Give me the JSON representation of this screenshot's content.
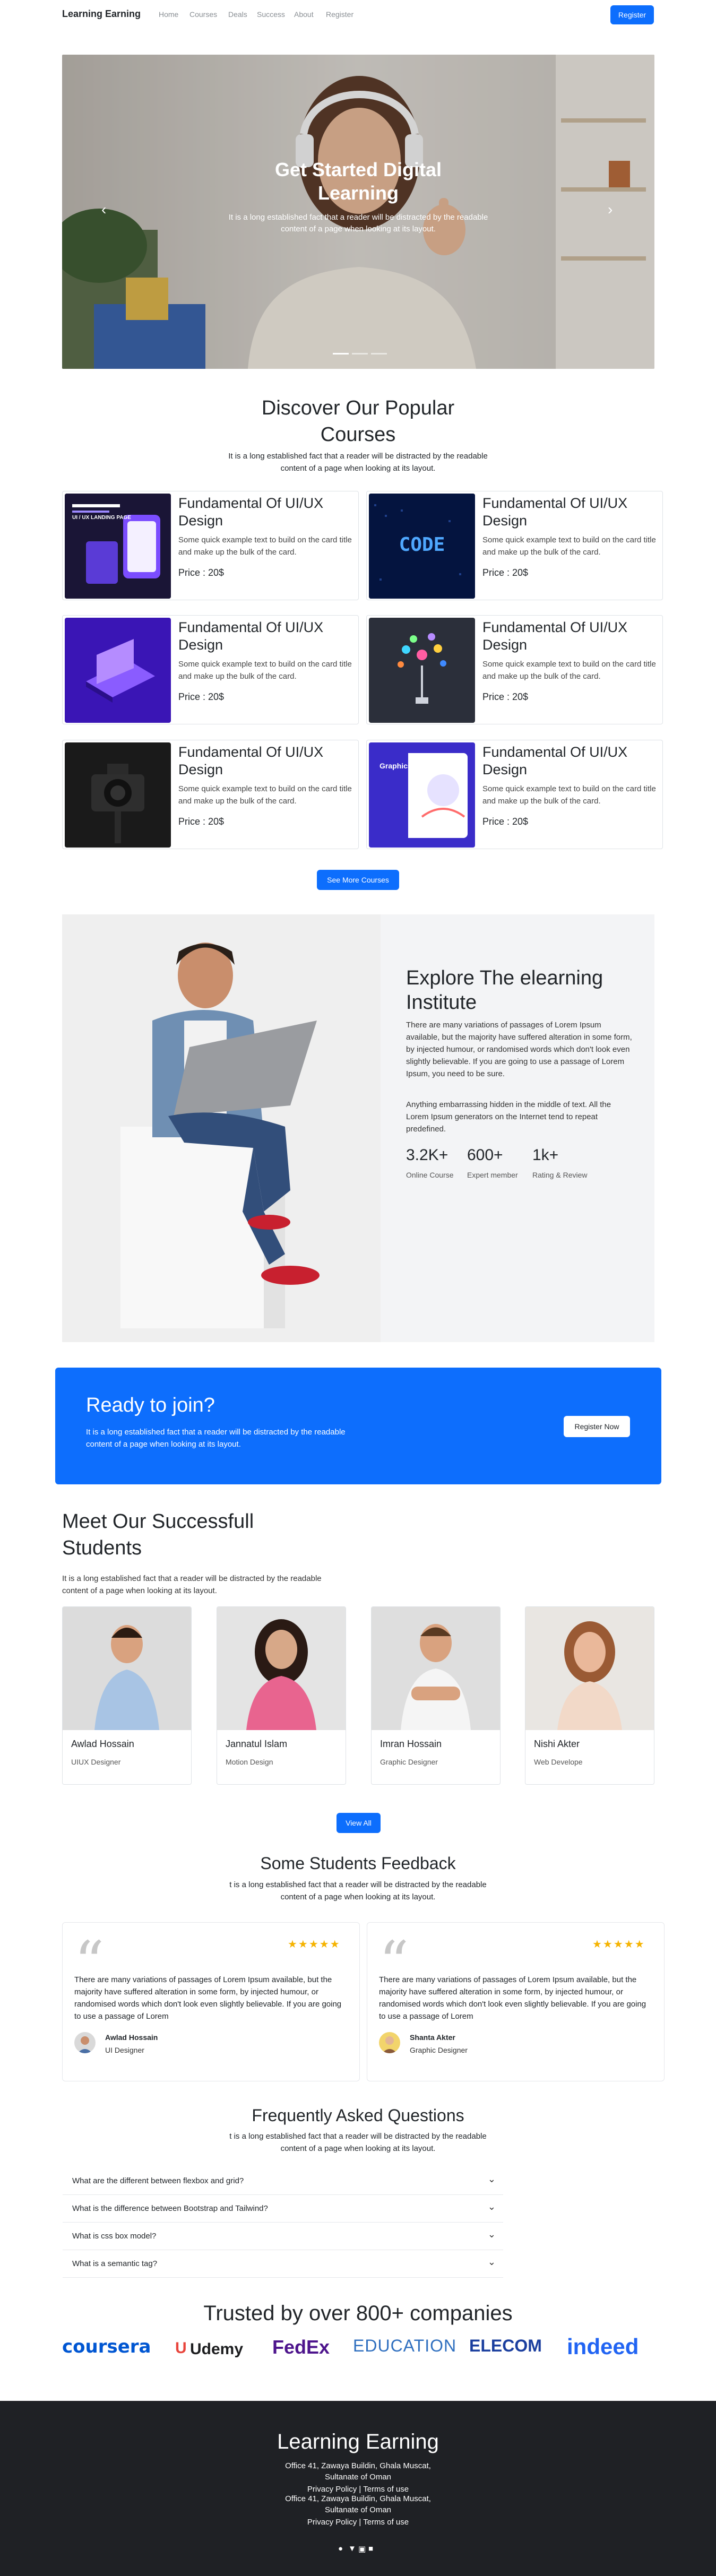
{
  "nav": {
    "brand": "Learning Earning",
    "links": [
      "Home",
      "Courses",
      "Deals",
      "Success",
      "About",
      "Register"
    ],
    "register_button": "Register"
  },
  "hero": {
    "title_line1": "Get Started Digital",
    "title_line2": "Learning",
    "text": "It is a long established fact that a reader will be distracted by the readable content of a page when looking at its layout.",
    "prev_icon": "chevron-left-icon",
    "next_icon": "chevron-right-icon"
  },
  "courses": {
    "title_line1": "Discover Our Popular",
    "title_line2": "Courses",
    "subtitle_line1": "It is a long established fact that a reader will be distracted by the readable",
    "subtitle_line2": "content of a page when looking at its layout.",
    "items": [
      {
        "title": "Fundamental Of UI/UX Design",
        "text": "Some quick example text to build on the card title and make up the bulk of the card.",
        "price": "Price : 20$",
        "image_text": "UI / UX LANDING PAGE",
        "accent": "#7b4dff"
      },
      {
        "title": "Fundamental Of UI/UX Design",
        "text": "Some quick example text to build on the card title and make up the bulk of the card.",
        "price": "Price : 20$",
        "image_text": "CODE",
        "accent": "#1e90ff"
      },
      {
        "title": "Fundamental Of UI/UX Design",
        "text": "Some quick example text to build on the card title and make up the bulk of the card.",
        "price": "Price : 20$",
        "image_text": "",
        "accent": "#6a2cff"
      },
      {
        "title": "Fundamental Of UI/UX Design",
        "text": "Some quick example text to build on the card title and make up the bulk of the card.",
        "price": "Price : 20$",
        "image_text": "",
        "accent": "#2b2f3a"
      },
      {
        "title": "Fundamental Of UI/UX Design",
        "text": "Some quick example text to build on the card title and make up the bulk of the card.",
        "price": "Price : 20$",
        "image_text": "",
        "accent": "#222222"
      },
      {
        "title": "Fundamental Of UI/UX Design",
        "text": "Some quick example text to build on the card title and make up the bulk of the card.",
        "price": "Price : 20$",
        "image_text": "Graphics",
        "accent": "#3a2cc9"
      }
    ],
    "see_more": "See More Courses"
  },
  "explore": {
    "title": "Explore The elearning Institute",
    "p1": "There are many variations of passages of Lorem Ipsum available, but the majority have suffered alteration in some form, by injected humour, or randomised words which don't look even slightly believable. If you are going to use a passage of Lorem Ipsum, you need to be sure.",
    "p2": "Anything embarrassing hidden in the middle of text. All the Lorem Ipsum generators on the Internet tend to repeat predefined.",
    "stats": [
      {
        "number": "3.2K+",
        "label": "Online Course"
      },
      {
        "number": "600+",
        "label": "Expert member"
      },
      {
        "number": "1k+",
        "label": "Rating & Review"
      }
    ]
  },
  "cta": {
    "title": "Ready to join?",
    "text": "It is a long established fact that a reader will be distracted by the readable content of a page when looking at its layout.",
    "button": "Register Now"
  },
  "students": {
    "title": "Meet Our Successfull Students",
    "subtitle": "It is a long established fact that a reader will be distracted by the readable content of a page when looking at its layout.",
    "items": [
      {
        "name": "Awlad Hossain",
        "role": "UIUX Designer"
      },
      {
        "name": "Jannatul Islam",
        "role": "Motion Design"
      },
      {
        "name": "Imran Hossain",
        "role": "Graphic Designer"
      },
      {
        "name": "Nishi Akter",
        "role": "Web Develope"
      }
    ],
    "view_all": "View All"
  },
  "feedback": {
    "title": "Some Students Feedback",
    "subtitle_line1": "t is a long established fact that a reader will be distracted by the readable",
    "subtitle_line2": "content of a page when looking at its layout.",
    "items": [
      {
        "text": "There are many variations of passages of Lorem Ipsum available, but the majority have suffered alteration in some form, by injected humour, or randomised words which don't look even slightly believable. If you are going to use a passage of Lorem",
        "name": "Awlad Hossain",
        "role": "UI Designer",
        "stars": "★★★★★"
      },
      {
        "text": "There are many variations of passages of Lorem Ipsum available, but the majority have suffered alteration in some form, by injected humour, or randomised words which don't look even slightly believable. If you are going to use a passage of Lorem",
        "name": "Shanta Akter",
        "role": "Graphic Designer",
        "stars": "★★★★★"
      }
    ]
  },
  "faq": {
    "title": "Frequently Asked Questions",
    "subtitle_line1": "t is a long established fact that a reader will be distracted by the readable",
    "subtitle_line2": "content of a page when looking at its layout.",
    "questions": [
      "What are the different between flexbox and grid?",
      "What is the difference between Bootstrap and Tailwind?",
      "What is css box model?",
      "What is a semantic tag?"
    ]
  },
  "trusted": {
    "title": "Trusted by over 800+ companies",
    "logos": [
      "coursera",
      "Udemy",
      "FedEx",
      "EDUCATION",
      "ELECOM",
      "indeed"
    ],
    "logo_colors": [
      "#0056d2",
      "#a435f0",
      "#4d148c",
      "#2f6fbf",
      "#1a3e9e",
      "#2164f3"
    ]
  },
  "footer": {
    "brand": "Learning Earning",
    "address_line1": "Office 41, Zawaya Buildin, Ghala Muscat,",
    "address_line2": "Sultanate of Oman",
    "links": "Privacy Policy | Terms of use",
    "social_icons": [
      "facebook-icon",
      "twitter-icon",
      "instagram-icon",
      "linkedin-icon"
    ]
  },
  "colors": {
    "primary": "#0d6efd",
    "footer_bg": "#1f2125",
    "star": "#f5b301"
  }
}
